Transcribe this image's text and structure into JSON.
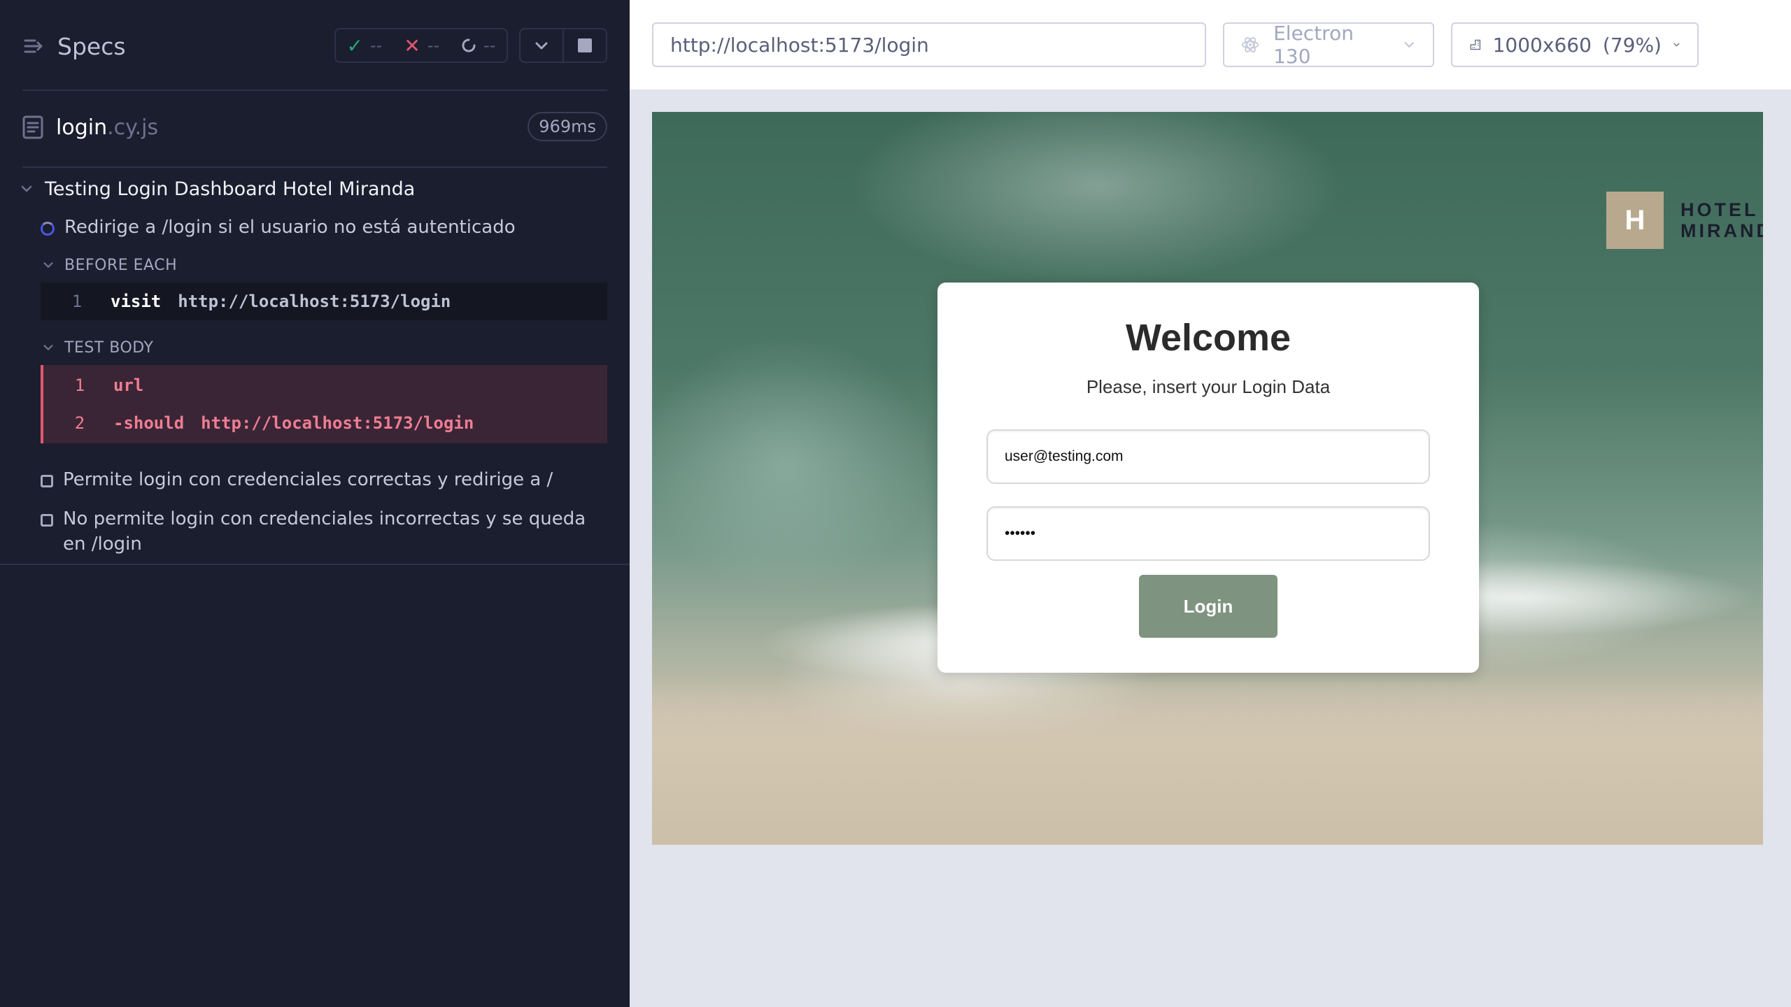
{
  "reporter": {
    "title": "Specs",
    "stats": {
      "passed": "--",
      "failed": "--",
      "pending": "--"
    },
    "spec": {
      "name": "login",
      "ext": ".cy.js",
      "duration": "969ms"
    },
    "suite": {
      "title": "Testing Login Dashboard Hotel Miranda"
    },
    "tests": [
      {
        "title": "Redirige a /login si el usuario no está autenticado",
        "state": "running",
        "hooks": [
          {
            "label": "BEFORE EACH",
            "commands": [
              {
                "num": "1",
                "name": "visit",
                "value": "http://localhost:5173/login"
              }
            ]
          },
          {
            "label": "TEST BODY",
            "commands": [
              {
                "num": "1",
                "name": "url",
                "value": ""
              },
              {
                "num": "2",
                "name": "-should",
                "value": "http://localhost:5173/login"
              }
            ]
          }
        ]
      },
      {
        "title": "Permite login con credenciales correctas y redirige a /",
        "state": "pending"
      },
      {
        "title": "No permite login con credenciales incorrectas y se queda en /login",
        "state": "pending"
      }
    ]
  },
  "aut_header": {
    "url": "http://localhost:5173/login",
    "browser": "Electron 130",
    "viewport": "1000x660",
    "zoom": "(79%)"
  },
  "app": {
    "logo": {
      "mark": "H",
      "line1": "HOTEL",
      "line2": "MIRAND"
    },
    "login": {
      "title": "Welcome",
      "subtitle": "Please, insert your Login Data",
      "email_value": "user@testing.com",
      "password_value": "123456",
      "button_label": "Login"
    }
  },
  "colors": {
    "reporter_bg": "#1b1e2e",
    "passed": "#1fa971",
    "failed": "#e45770",
    "running": "#4956e3",
    "login_button": "#7e9380",
    "logo_mark": "#b8a98e"
  }
}
